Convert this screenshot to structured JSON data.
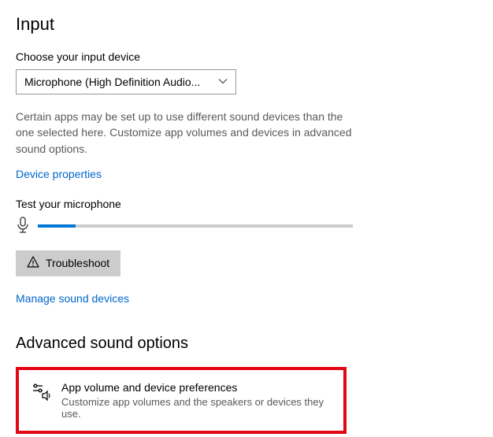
{
  "input": {
    "section_title": "Input",
    "choose_label": "Choose your input device",
    "device_selected": "Microphone (High Definition Audio...",
    "description": "Certain apps may be set up to use different sound devices than the one selected here. Customize app volumes and devices in advanced sound options.",
    "device_properties_link": "Device properties",
    "test_label": "Test your microphone",
    "mic_level_percent": 12,
    "troubleshoot_label": "Troubleshoot",
    "manage_link": "Manage sound devices"
  },
  "advanced": {
    "section_title": "Advanced sound options",
    "pref_title": "App volume and device preferences",
    "pref_desc": "Customize app volumes and the speakers or devices they use."
  }
}
